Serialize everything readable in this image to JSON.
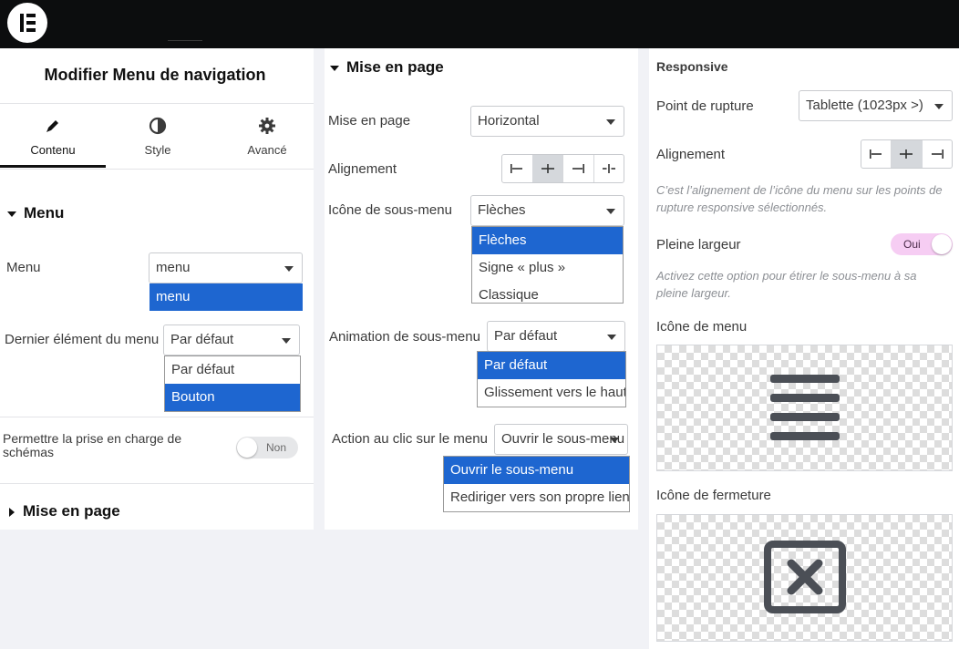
{
  "left_panel": {
    "title": "Modifier Menu de navigation",
    "tabs": [
      {
        "label": "Contenu",
        "icon": "pencil-icon"
      },
      {
        "label": "Style",
        "icon": "half-circle-icon"
      },
      {
        "label": "Avancé",
        "icon": "gear-icon"
      }
    ],
    "section_menu": "Menu",
    "menu_label": "Menu",
    "menu_value": "menu",
    "menu_options": [
      "menu"
    ],
    "last_item_label": "Dernier élément du menu",
    "last_item_value": "Par défaut",
    "last_item_options": [
      "Par défaut",
      "Bouton"
    ],
    "schema_label": "Permettre la prise en charge de schémas",
    "schema_toggle": "Non",
    "section_layout": "Mise en page"
  },
  "middle_panel": {
    "section_title": "Mise en page",
    "layout_label": "Mise en page",
    "layout_value": "Horizontal",
    "align_label": "Alignement",
    "submenu_icon_label": "Icône de sous-menu",
    "submenu_icon_value": "Flèches",
    "submenu_icon_options": [
      "Flèches",
      "Signe « plus »",
      "Classique"
    ],
    "submenu_anim_label": "Animation de sous-menu",
    "submenu_anim_value": "Par défaut",
    "submenu_anim_options": [
      "Par défaut",
      "Glissement vers le haut"
    ],
    "click_action_label": "Action au clic sur le menu",
    "click_action_value": "Ouvrir le sous-menu",
    "click_action_options": [
      "Ouvrir le sous-menu",
      "Rediriger vers son propre lien"
    ]
  },
  "right_panel": {
    "section_title": "Responsive",
    "breakpoint_label": "Point de rupture",
    "breakpoint_value": "Tablette (1023px >)",
    "align_label": "Alignement",
    "align_hint": "C’est l’alignement de l’icône du menu sur les points de rupture responsive sélectionnés.",
    "full_width_label": "Pleine largeur",
    "full_width_toggle": "Oui",
    "full_width_hint": "Activez cette option pour étirer le sous-menu à sa pleine largeur.",
    "menu_icon_label": "Icône de menu",
    "close_icon_label": "Icône de fermeture"
  },
  "colors": {
    "accent": "#1e66d0",
    "toggle_on": "#f6cdf3",
    "topbar": "#0c0d0e"
  }
}
